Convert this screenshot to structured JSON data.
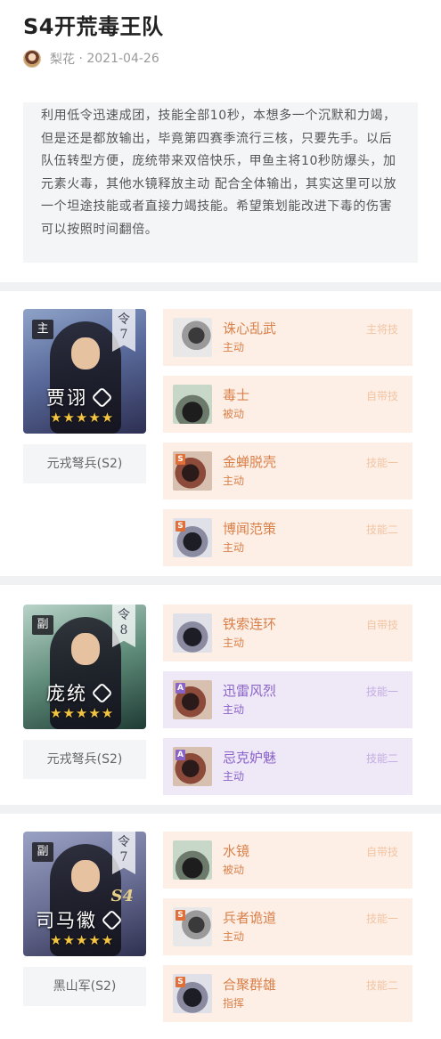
{
  "header": {
    "title": "S4开荒毒王队",
    "author": "梨花",
    "date": "2021-04-26"
  },
  "description": "利用低令迅速成团，技能全部10秒，本想多一个沉默和力竭，但是还是都放输出，毕竟第四赛季流行三核，只要先手。以后队伍转型方便，庞统带来双倍快乐，甲鱼主将10秒防爆头，加元素火毒，其他水镜释放主动 配合全体输出，其实这里可以放一个坦途技能或者直接力竭技能。希望策划能改进下毒的伤害可以按照时间翻倍。",
  "teams": [
    {
      "role": "主",
      "ling_label": "令",
      "ling_value": "7",
      "hero_name": "贾诩",
      "season_tag": "",
      "stars": "★★★★★",
      "army": "元戎弩兵(S2)",
      "skills": [
        {
          "name": "诛心乱武",
          "type": "主动",
          "tag": "主将技",
          "grade": "",
          "color": "orange",
          "icon": "chaos-icon"
        },
        {
          "name": "毒士",
          "type": "被动",
          "tag": "自带技",
          "grade": "",
          "color": "orange",
          "icon": "poison-scholar-icon"
        },
        {
          "name": "金蝉脱壳",
          "type": "主动",
          "tag": "技能一",
          "grade": "S",
          "color": "orange",
          "icon": "cicada-icon"
        },
        {
          "name": "博闻范策",
          "type": "主动",
          "tag": "技能二",
          "grade": "S",
          "color": "orange",
          "icon": "scroll-icon"
        }
      ]
    },
    {
      "role": "副",
      "ling_label": "令",
      "ling_value": "8",
      "hero_name": "庞统",
      "season_tag": "",
      "stars": "★★★★★",
      "army": "元戎弩兵(S2)",
      "skills": [
        {
          "name": "铁索连环",
          "type": "主动",
          "tag": "自带技",
          "grade": "",
          "color": "orange",
          "icon": "chain-icon"
        },
        {
          "name": "迅雷风烈",
          "type": "主动",
          "tag": "技能一",
          "grade": "A",
          "color": "purple",
          "icon": "thunder-icon"
        },
        {
          "name": "忌克妒魅",
          "type": "主动",
          "tag": "技能二",
          "grade": "A",
          "color": "purple",
          "icon": "jealousy-icon"
        }
      ]
    },
    {
      "role": "副",
      "ling_label": "令",
      "ling_value": "7",
      "hero_name": "司马徽",
      "season_tag": "S4",
      "stars": "★★★★★",
      "army": "黑山军(S2)",
      "skills": [
        {
          "name": "水镜",
          "type": "被动",
          "tag": "自带技",
          "grade": "",
          "color": "orange",
          "icon": "water-mirror-icon"
        },
        {
          "name": "兵者诡道",
          "type": "主动",
          "tag": "技能一",
          "grade": "S",
          "color": "orange",
          "icon": "deception-icon"
        },
        {
          "name": "合聚群雄",
          "type": "指挥",
          "tag": "技能二",
          "grade": "S",
          "color": "orange",
          "icon": "gather-heroes-icon"
        }
      ]
    }
  ]
}
